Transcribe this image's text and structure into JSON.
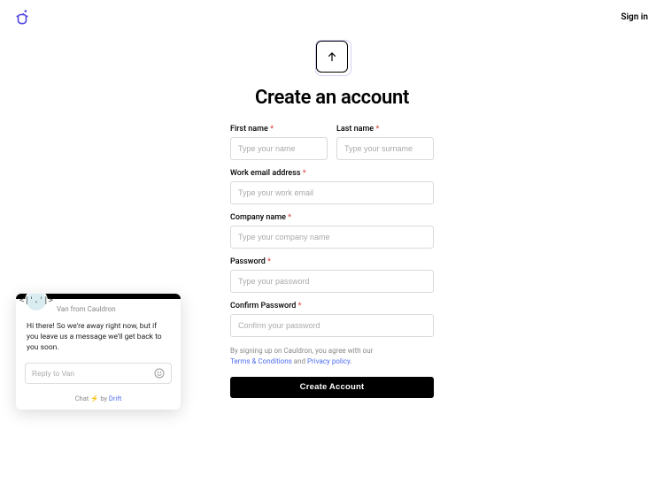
{
  "header": {
    "signin": "Sign in"
  },
  "page": {
    "title": "Create an account"
  },
  "form": {
    "first_name": {
      "label": "First name",
      "placeholder": "Type your name"
    },
    "last_name": {
      "label": "Last name",
      "placeholder": "Type your surname"
    },
    "email": {
      "label": "Work email address",
      "placeholder": "Type your work email"
    },
    "company": {
      "label": "Company name",
      "placeholder": "Type your company name"
    },
    "password": {
      "label": "Password",
      "placeholder": "Type your password"
    },
    "confirm": {
      "label": "Confirm Password",
      "placeholder": "Confirm your password"
    },
    "required_mark": "*",
    "legal_prefix": "By signing up on Cauldron, you agree with our ",
    "legal_terms": "Terms & Conditions",
    "legal_and": " and ",
    "legal_privacy": "Privacy policy",
    "legal_suffix": ".",
    "submit": "Create Account"
  },
  "chat": {
    "avatar_text": "<|'.'|>",
    "from": "Van from Cauldron",
    "message": "Hi there! So we're away right now, but if you leave us a message we'll get back to you soon.",
    "reply_placeholder": "Reply to Van",
    "footer_chat": "Chat",
    "footer_bolt": "⚡",
    "footer_by": " by ",
    "footer_drift": "Drift"
  }
}
